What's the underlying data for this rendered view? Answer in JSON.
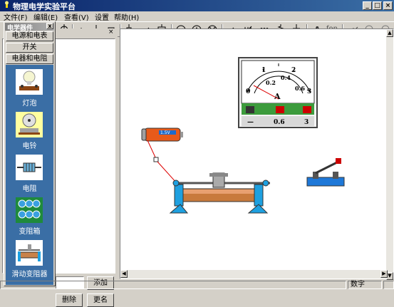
{
  "window": {
    "title": "物理电学实验平台"
  },
  "menu": [
    {
      "label": "文件(F)"
    },
    {
      "label": "编辑(E)"
    },
    {
      "label": "查看(V)"
    },
    {
      "label": "设置"
    },
    {
      "label": "帮助(H)"
    }
  ],
  "toolbar": {
    "text_tool": "A",
    "font_tool": "fon"
  },
  "palette": {
    "title": "电学器件",
    "close": "x",
    "categories": [
      {
        "label": "电源和电表"
      },
      {
        "label": "开关"
      },
      {
        "label": "电器和电阻"
      }
    ],
    "components": [
      {
        "label": "灯泡",
        "icon": "lamp-icon"
      },
      {
        "label": "电铃",
        "icon": "bell-icon"
      },
      {
        "label": "电阻",
        "icon": "resistor-icon"
      },
      {
        "label": "变阻箱",
        "icon": "resistance-box-icon"
      },
      {
        "label": "滑动变阻器",
        "icon": "rheostat-icon"
      }
    ]
  },
  "left_panel": {
    "add_button": "添加",
    "delete_button": "删除",
    "rename_button": "更名",
    "name_value": ""
  },
  "canvas": {
    "ammeter": {
      "scale": [
        "0",
        "1",
        "2",
        "3"
      ],
      "inner_scale": [
        "0.2",
        "0.4",
        "0.6"
      ],
      "unit": "A",
      "terminals": [
        "—",
        "0.6",
        "3"
      ]
    },
    "battery": {
      "label": "1.5V"
    }
  },
  "status": {
    "mode": "数字"
  }
}
